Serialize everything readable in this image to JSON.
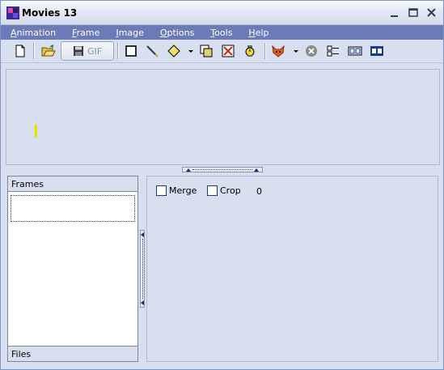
{
  "window": {
    "title": "Movies 13"
  },
  "menu": [
    {
      "label": "Animation",
      "accel": "A",
      "rest": "nimation"
    },
    {
      "label": "Frame",
      "accel": "F",
      "rest": "rame"
    },
    {
      "label": "Image",
      "accel": "I",
      "rest": "mage"
    },
    {
      "label": "Options",
      "accel": "O",
      "rest": "ptions"
    },
    {
      "label": "Tools",
      "accel": "T",
      "rest": "ools"
    },
    {
      "label": "Help",
      "accel": "H",
      "rest": "elp"
    }
  ],
  "toolbar": {
    "gif_label": "GIF",
    "icons": [
      "new-icon",
      "open-icon",
      "save-gif-icon",
      "rectangle-icon",
      "pencil-icon",
      "diamond-icon",
      "duplicate-frame-icon",
      "delete-frame-icon",
      "timer-icon",
      "fox-icon",
      "stop-icon",
      "align-frames-icon",
      "film-strip-icon",
      "film-strip-blue-icon"
    ]
  },
  "frames_panel": {
    "header": "Frames",
    "footer": "Files"
  },
  "properties": {
    "merge_label": "Merge",
    "merge_checked": false,
    "crop_label": "Crop",
    "crop_checked": false,
    "count": "0"
  },
  "colors": {
    "menubar": "#6a7bb8",
    "background": "#d8e0f0"
  }
}
